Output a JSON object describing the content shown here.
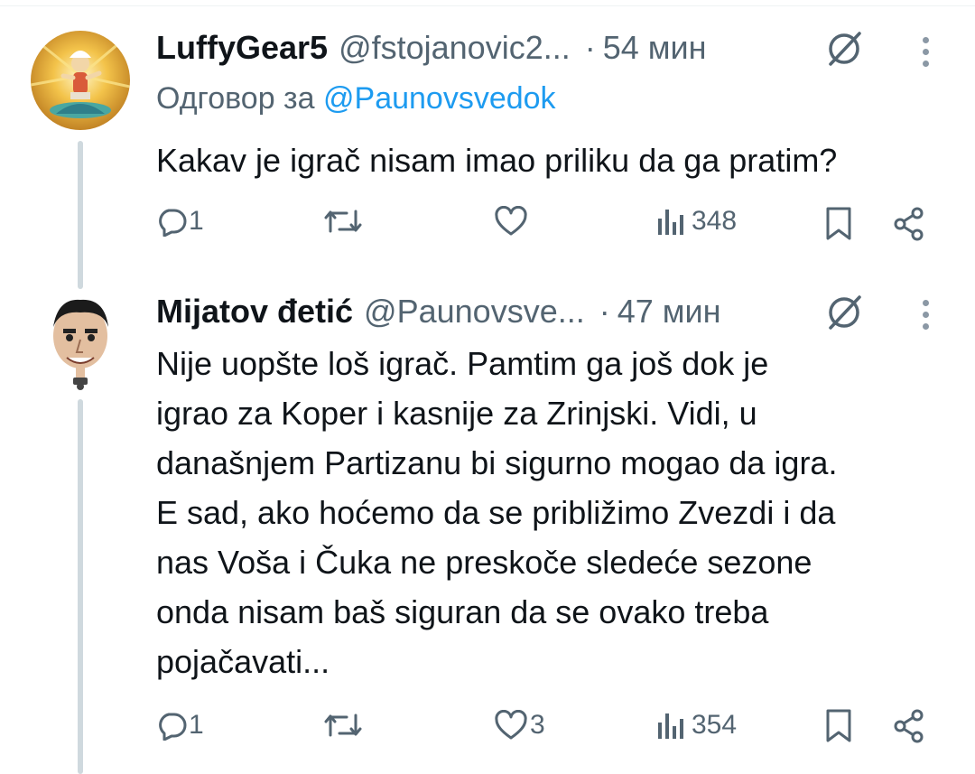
{
  "tweets": [
    {
      "name": "LuffyGear5",
      "handle": "@fstojanovic2...",
      "separator": "·",
      "time": "54 мин",
      "reply_prefix": "Одговор за",
      "reply_handle": "@Paunovsvedok",
      "text": "Kakav je igrač nisam imao priliku da ga pratim?",
      "replies": "1",
      "retweets": "",
      "likes": "",
      "views": "348"
    },
    {
      "name": "Mijatov đetić",
      "handle": "@Paunovsve...",
      "separator": "·",
      "time": "47 мин",
      "text_lines": [
        "Nije uopšte loš igrač. Pamtim ga još dok je",
        "igrao za Koper i kasnije za Zrinjski. Vidi, u",
        "današnjem Partizanu bi sigurno mogao da igra.",
        "E sad, ako hoćemo da se približimo Zvezdi i da",
        "nas Voša i Čuka ne preskoče sledeće sezone",
        "onda nisam baš siguran da se ovako treba",
        "pojačavati..."
      ],
      "replies": "1",
      "retweets": "",
      "likes": "3",
      "views": "354"
    }
  ],
  "icons": {
    "reply": "speech-bubble-icon",
    "retweet": "retweet-arrows-icon",
    "like": "heart-icon",
    "views": "bar-chart-icon",
    "bookmark": "bookmark-icon",
    "share": "share-icon",
    "grok": "grok-slash-circle-icon",
    "more": "vertical-dots-icon"
  },
  "colors": {
    "text": "#0f1419",
    "muted": "#536471",
    "link": "#1d9bf0",
    "thread_line": "#cfd9de"
  }
}
